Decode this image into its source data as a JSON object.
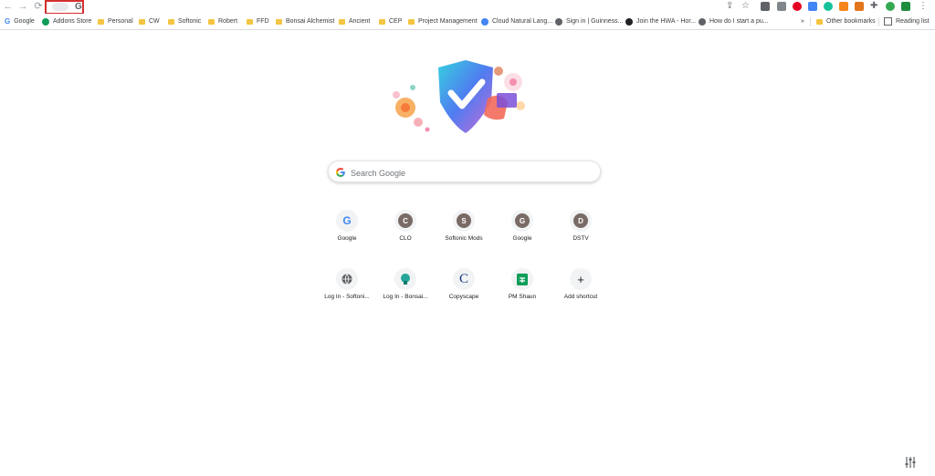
{
  "toolbar": {
    "back_icon": "arrow-left-icon",
    "forward_icon": "arrow-right-icon",
    "reload_icon": "reload-icon",
    "tab_favicon": "G",
    "icons": [
      "share-icon",
      "star-icon",
      "adblock-shield-icon",
      "ext-icon",
      "pinterest-icon",
      "translate-icon",
      "grammarly-icon",
      "metamask-icon",
      "fox-icon",
      "puzzle-icon",
      "profile-icon",
      "check-shield-icon",
      "menu-icon"
    ]
  },
  "bookmarks": {
    "items": [
      {
        "label": "Google",
        "type": "google"
      },
      {
        "label": "Addons Store",
        "type": "site"
      },
      {
        "label": "Personal",
        "type": "folder"
      },
      {
        "label": "CW",
        "type": "folder"
      },
      {
        "label": "Softonic",
        "type": "folder"
      },
      {
        "label": "Robert",
        "type": "folder"
      },
      {
        "label": "FFD",
        "type": "folder"
      },
      {
        "label": "Bonsai Alchemist",
        "type": "folder"
      },
      {
        "label": "Ancient",
        "type": "folder"
      },
      {
        "label": "CEP",
        "type": "folder"
      },
      {
        "label": "Project Management",
        "type": "folder"
      },
      {
        "label": "Cloud Natural Lang...",
        "type": "site"
      },
      {
        "label": "Sign in | Guinness...",
        "type": "site"
      },
      {
        "label": "Join the HWA - Hor...",
        "type": "site"
      },
      {
        "label": "How do I start a pu...",
        "type": "site"
      }
    ],
    "overflow": "»",
    "other": "Other bookmarks",
    "reading_list": "Reading list"
  },
  "search": {
    "placeholder": "Search Google"
  },
  "shortcuts": [
    {
      "label": "Google",
      "letter": "G"
    },
    {
      "label": "CLO",
      "letter": "C"
    },
    {
      "label": "Softonic Mods",
      "letter": "S"
    },
    {
      "label": "Google",
      "letter": "G"
    },
    {
      "label": "DSTV",
      "letter": "D"
    },
    {
      "label": "Log In - Softoni...",
      "letter": ""
    },
    {
      "label": "Log In - Bonsai...",
      "letter": ""
    },
    {
      "label": "Copyscape",
      "letter": "C"
    },
    {
      "label": "PM Shaun",
      "letter": ""
    },
    {
      "label": "Add shortcut",
      "letter": "+"
    }
  ],
  "colors": {
    "accent": "#1a73e8",
    "highlight_border": "#d32f2f",
    "letter_tile": "#7a6a66"
  }
}
